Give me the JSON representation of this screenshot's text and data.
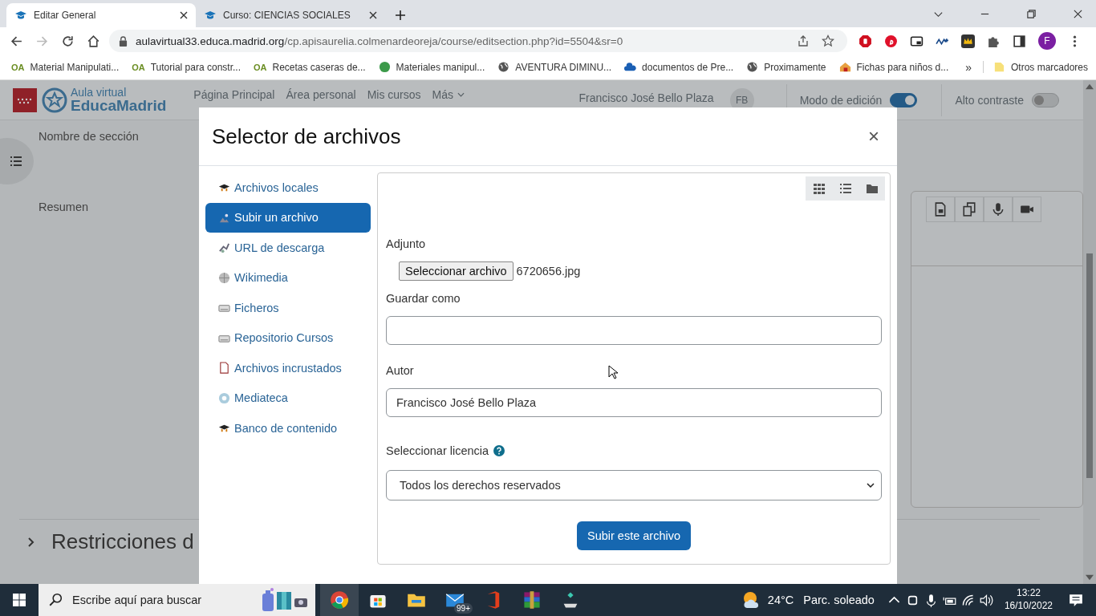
{
  "browser": {
    "tabs": [
      {
        "title": "Editar General",
        "selected": true
      },
      {
        "title": "Curso: CIENCIAS SOCIALES",
        "selected": false
      }
    ],
    "url_host": "aulavirtual33.educa.madrid.org",
    "url_path": "/cp.apisaurelia.colmenardeoreja/course/editsection.php?id=5504&sr=0",
    "profile_initial": "F",
    "bookmarks": [
      {
        "label": "Material Manipulati...",
        "kind": "oa",
        "badge": "OA"
      },
      {
        "label": "Tutorial para constr...",
        "kind": "oa",
        "badge": "OA"
      },
      {
        "label": "Recetas caseras de...",
        "kind": "oa",
        "badge": "OA"
      },
      {
        "label": "Materiales manipul...",
        "kind": "dot"
      },
      {
        "label": "AVENTURA DIMINU...",
        "kind": "globe"
      },
      {
        "label": "documentos de Pre...",
        "kind": "cloud"
      },
      {
        "label": "Proximamente",
        "kind": "globe"
      },
      {
        "label": "Fichas para niños d...",
        "kind": "house"
      }
    ],
    "more_bookmarks": "»",
    "other_bookmarks": "Otros marcadores"
  },
  "page": {
    "logo_top": "Aula virtual",
    "logo_bottom": "EducaMadrid",
    "nav": [
      "Página Principal",
      "Área personal",
      "Mis cursos",
      "Más"
    ],
    "user_name": "Francisco José Bello Plaza",
    "user_initials": "FB",
    "toggles": [
      {
        "label": "Modo de edición",
        "on": true
      },
      {
        "label": "Alto contraste",
        "on": false
      }
    ],
    "section_name_label": "Nombre de sección",
    "summary_label": "Resumen",
    "restrictions_heading": "Restricciones d"
  },
  "modal": {
    "title": "Selector de archivos",
    "close": "×",
    "repositories": [
      {
        "label": "Archivos locales",
        "kind": "cap",
        "selected": false
      },
      {
        "label": "Subir un archivo",
        "kind": "upload",
        "selected": true
      },
      {
        "label": "URL de descarga",
        "kind": "link",
        "selected": false
      },
      {
        "label": "Wikimedia",
        "kind": "globe",
        "selected": false
      },
      {
        "label": "Ficheros",
        "kind": "drive",
        "selected": false
      },
      {
        "label": "Repositorio Cursos",
        "kind": "drive",
        "selected": false
      },
      {
        "label": "Archivos incrustados",
        "kind": "file",
        "selected": false
      },
      {
        "label": "Mediateca",
        "kind": "media",
        "selected": false
      },
      {
        "label": "Banco de contenido",
        "kind": "cap",
        "selected": false
      }
    ],
    "attachment_label": "Adjunto",
    "choose_button": "Seleccionar archivo",
    "chosen_file": "6720656.jpg",
    "save_as_label": "Guardar como",
    "author_label": "Autor",
    "author_value": "Francisco José Bello Plaza",
    "license_label": "Seleccionar licencia",
    "license_value": "Todos los derechos reservados",
    "upload_button": "Subir este archivo"
  },
  "taskbar": {
    "search_placeholder": "Escribe aquí para buscar",
    "mail_badge": "99+",
    "temperature": "24°C",
    "weather": "Parc. soleado",
    "time": "13:22",
    "date": "16/10/2022"
  }
}
